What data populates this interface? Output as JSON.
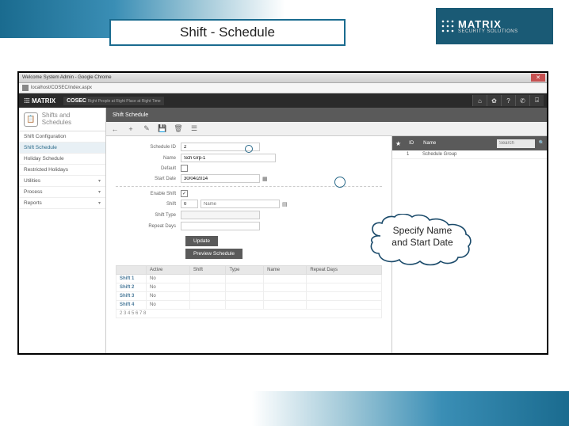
{
  "slide_title": "Shift - Schedule",
  "brand": {
    "name": "MATRIX",
    "tagline": "SECURITY SOLUTIONS"
  },
  "browser": {
    "window_title": "Welcome System Admin - Google Chrome",
    "url": "localhost/COSEC/index.aspx"
  },
  "app": {
    "brand": "MATRIX",
    "product": "COSEC",
    "tagline": "Right People at Right Place at Right Time",
    "header_icons": [
      "home-icon",
      "gear-icon",
      "question-icon",
      "phone-icon",
      "logout-icon"
    ]
  },
  "sidebar": {
    "header": "Shifts and Schedules",
    "items": [
      {
        "label": "Shift Configuration",
        "active": false,
        "expandable": false
      },
      {
        "label": "Shift Schedule",
        "active": true,
        "expandable": false
      },
      {
        "label": "Holiday Schedule",
        "active": false,
        "expandable": false
      },
      {
        "label": "Restricted Holidays",
        "active": false,
        "expandable": false
      },
      {
        "label": "Utilities",
        "active": false,
        "expandable": true
      },
      {
        "label": "Process",
        "active": false,
        "expandable": true
      },
      {
        "label": "Reports",
        "active": false,
        "expandable": true
      }
    ]
  },
  "panel": {
    "title": "Shift Schedule",
    "toolbar": [
      "back-icon",
      "add-icon",
      "edit-icon",
      "save-icon",
      "delete-icon",
      "list-icon"
    ]
  },
  "form": {
    "schedule_id": {
      "label": "Schedule ID",
      "value": "2"
    },
    "name": {
      "label": "Name",
      "value": "Sch Grp-1"
    },
    "default": {
      "label": "Default",
      "checked": false
    },
    "start_date": {
      "label": "Start Date",
      "value": "30/04/2014"
    },
    "enable_shift": {
      "label": "Enable Shift",
      "checked": true
    },
    "shift": {
      "label": "Shift",
      "value": "0",
      "name_placeholder": "Name"
    },
    "shift_type": {
      "label": "Shift Type",
      "value": ""
    },
    "repeat_days": {
      "label": "Repeat Days",
      "value": ""
    },
    "update_btn": "Update",
    "preview_btn": "Preview Schedule"
  },
  "shift_table": {
    "columns": [
      "",
      "Active",
      "Shift",
      "Type",
      "Name",
      "Repeat Days"
    ],
    "rows": [
      {
        "label": "Shift 1",
        "active": "No",
        "shift": "",
        "type": "",
        "name": "",
        "repeat": ""
      },
      {
        "label": "Shift 2",
        "active": "No",
        "shift": "",
        "type": "",
        "name": "",
        "repeat": ""
      },
      {
        "label": "Shift 3",
        "active": "No",
        "shift": "",
        "type": "",
        "name": "",
        "repeat": ""
      },
      {
        "label": "Shift 4",
        "active": "No",
        "shift": "",
        "type": "",
        "name": "",
        "repeat": ""
      }
    ],
    "pagination": "2 3 4 5 6 7 8"
  },
  "detail": {
    "columns": [
      "",
      "ID",
      "Name"
    ],
    "search_placeholder": "Search",
    "rows": [
      {
        "star": "",
        "id": "1",
        "name": "Schedule Group"
      }
    ]
  },
  "callout_text": "Specify Name and Start Date"
}
